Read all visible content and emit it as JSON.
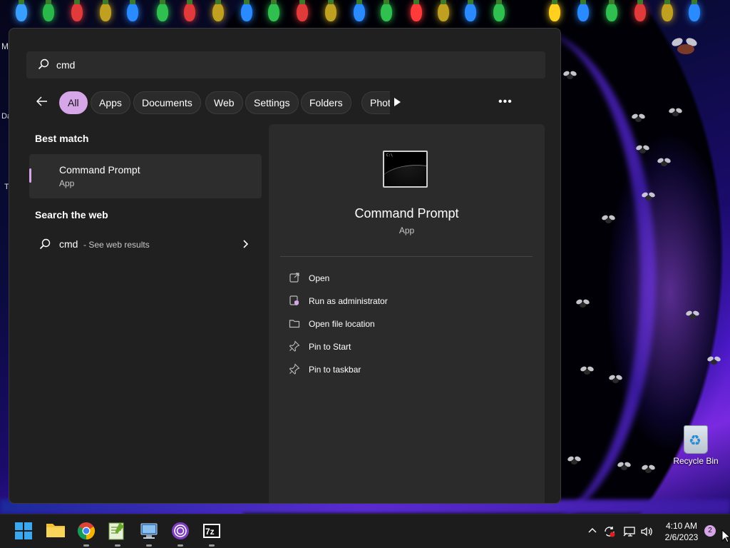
{
  "search": {
    "query": "cmd"
  },
  "filters": {
    "chips": [
      "All",
      "Apps",
      "Documents",
      "Web",
      "Settings",
      "Folders",
      "Photos"
    ],
    "active": "All",
    "photos_visible": "Phot"
  },
  "best_match": {
    "section_title": "Best match",
    "name": "Command Prompt",
    "kind": "App"
  },
  "web": {
    "section_title": "Search the web",
    "query": "cmd",
    "hint": "- See web results"
  },
  "preview": {
    "title": "Command Prompt",
    "kind": "App",
    "actions": [
      {
        "label": "Open",
        "icon": "open-external-icon"
      },
      {
        "label": "Run as administrator",
        "icon": "shield-admin-icon"
      },
      {
        "label": "Open file location",
        "icon": "folder-icon"
      },
      {
        "label": "Pin to Start",
        "icon": "pin-icon"
      },
      {
        "label": "Pin to taskbar",
        "icon": "pin-icon"
      }
    ]
  },
  "desktop": {
    "recycle_bin_label": "Recycle Bin",
    "edge_text_1": "M",
    "edge_text_2": "Da",
    "edge_text_3": "T"
  },
  "taskbar": {
    "apps": [
      "start-button",
      "file-explorer",
      "chrome",
      "notepad-plus",
      "remote-desktop",
      "tor-browser",
      "7-zip"
    ],
    "time": "4:10 AM",
    "date": "2/6/2023",
    "notification_count": "2"
  },
  "colors": {
    "accent": "#d7a6e8",
    "panel_bg": "#202020",
    "preview_bg": "#2b2b2b",
    "taskbar_bg": "#1c1c1c"
  }
}
